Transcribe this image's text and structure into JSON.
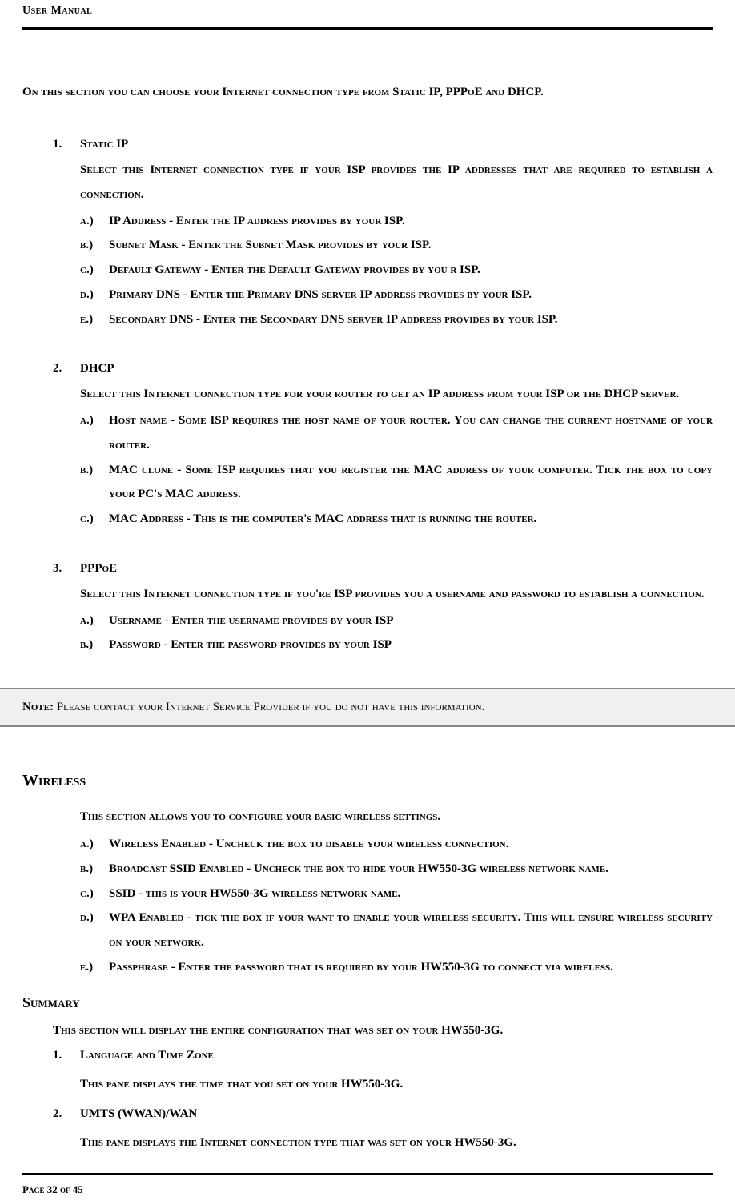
{
  "header": "User Manual",
  "intro": "On this section you can choose your Internet connection type from Static IP, PPPoE and DHCP.",
  "sections": [
    {
      "num": "1.",
      "title": "Static IP",
      "body": "Select this Internet connection type if your ISP provides the IP addresses that are required to establish a connection.",
      "subs": [
        {
          "l": "a.)",
          "t": "IP Address - Enter the IP address provides by your ISP."
        },
        {
          "l": "b.)",
          "t": "Subnet Mask - Enter the Subnet Mask provides by your ISP."
        },
        {
          "l": "c.)",
          "t": "Default Gateway - Enter the Default Gateway provides by you r ISP."
        },
        {
          "l": "d.)",
          "t": "Primary DNS - Enter the Primary DNS server IP address provides by your ISP."
        },
        {
          "l": "e.)",
          "t": "Secondary DNS - Enter the Secondary DNS server IP address provides by your ISP."
        }
      ]
    },
    {
      "num": "2.",
      "title": "DHCP",
      "body": "Select this Internet connection type for your router to get an IP address from your ISP or the DHCP server.",
      "subs": [
        {
          "l": "a.)",
          "t": "Host name - Some ISP requires the host name of your router. You can change the current hostname of your router."
        },
        {
          "l": "b.)",
          "t": "MAC clone - Some ISP requires that you register the MAC address of your computer. Tick the box to copy your PC's MAC address."
        },
        {
          "l": "c.)",
          "t": "MAC Address - This is the computer's MAC address that is running the router."
        }
      ]
    },
    {
      "num": "3.",
      "title": "PPPoE",
      "body": "Select this Internet connection type if you're ISP provides you a username and password to establish a connection.",
      "subs": [
        {
          "l": "a.)",
          "t": "Username - Enter the username provides by your ISP"
        },
        {
          "l": "b.)",
          "t": "Password - Enter the password provides by your ISP"
        }
      ]
    }
  ],
  "note_label": "Note:",
  "note_text": " Please contact your Internet Service Provider if you do not have this information.",
  "wireless": {
    "heading": "Wireless",
    "body": "This section allows you to configure your basic wireless settings.",
    "subs": [
      {
        "l": "a.)",
        "t": "Wireless Enabled - Uncheck the box to disable your wireless connection."
      },
      {
        "l": "b.)",
        "t": "Broadcast SSID Enabled - Uncheck the box to hide your HW550-3G wireless network name."
      },
      {
        "l": "c.)",
        "t": "SSID - this is your HW550-3G wireless network name."
      },
      {
        "l": "d.)",
        "t": "WPA Enabled - tick the box if your want to enable your wireless security. This will ensure wireless security on your network."
      },
      {
        "l": "e.)",
        "t": "Passphrase - Enter the password that is required by your HW550-3G to connect via wireless."
      }
    ]
  },
  "summary": {
    "heading": "Summary",
    "intro": "This section will display the entire configuration that was set on your HW550-3G.",
    "items": [
      {
        "num": "1.",
        "title": "Language and Time Zone",
        "body": "This pane displays the time that you set on your HW550-3G."
      },
      {
        "num": "2.",
        "title": "UMTS (WWAN)/WAN",
        "body": "This pane displays the Internet connection type that was set on your HW550-3G."
      }
    ]
  },
  "footer": "Page 32 of 45"
}
